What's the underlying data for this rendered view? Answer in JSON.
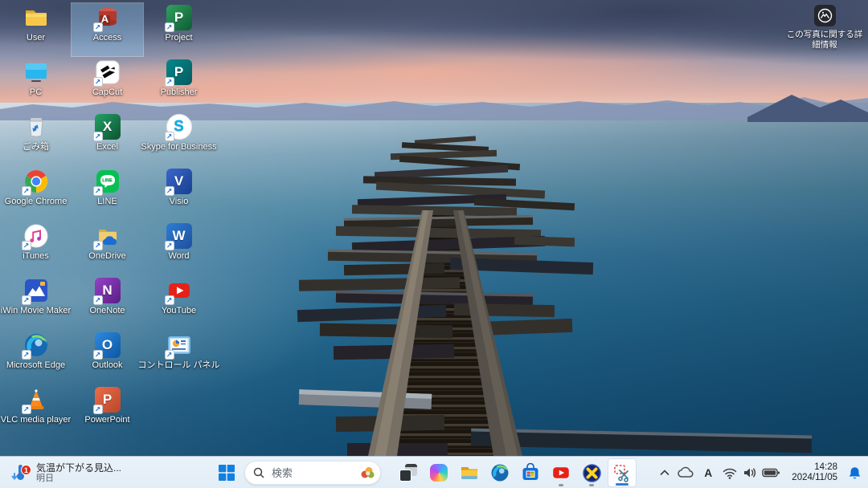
{
  "desktop": {
    "spotlight_label": "この写真に関する詳細情報",
    "selected_icon": "Access",
    "icons": [
      {
        "label": "User"
      },
      {
        "label": "PC"
      },
      {
        "label": "ごみ箱"
      },
      {
        "label": "Google Chrome"
      },
      {
        "label": "iTunes"
      },
      {
        "label": "iWin Movie Maker"
      },
      {
        "label": "Microsoft Edge"
      },
      {
        "label": "VLC media player"
      },
      {
        "label": "Access",
        "glyph": "A"
      },
      {
        "label": "CapCut"
      },
      {
        "label": "Excel",
        "glyph": "X"
      },
      {
        "label": "LINE",
        "glyph": "LINE"
      },
      {
        "label": "OneDrive"
      },
      {
        "label": "OneNote",
        "glyph": "N"
      },
      {
        "label": "Outlook",
        "glyph": "O"
      },
      {
        "label": "PowerPoint",
        "glyph": "P"
      },
      {
        "label": "Project",
        "glyph": "P"
      },
      {
        "label": "Publisher",
        "glyph": "P"
      },
      {
        "label": "Skype for Business",
        "glyph": "S"
      },
      {
        "label": "Visio",
        "glyph": "V"
      },
      {
        "label": "Word",
        "glyph": "W"
      },
      {
        "label": "YouTube"
      },
      {
        "label": "コントロール パネル"
      }
    ]
  },
  "taskbar": {
    "widget": {
      "badge": "1",
      "line1": "気温が下がる見込...",
      "line2": "明日"
    },
    "search": {
      "placeholder": "検索"
    },
    "apps": [
      "start",
      "task-view",
      "copilot",
      "file-explorer",
      "edge",
      "microsoft-store",
      "youtube",
      "x-app",
      "snipping-tool"
    ],
    "active_app": "snipping-tool",
    "running_apps": [
      "youtube",
      "x-app",
      "snipping-tool"
    ],
    "tray": {
      "ime": "A",
      "time": "14:28",
      "date": "2024/11/05"
    }
  },
  "colors": {
    "taskbar_bg": "#e6eff7",
    "accent_blue": "#1a7fd4",
    "selection": "rgba(145,190,228,0.45)",
    "water_deep": "#124a6e",
    "sky_pink": "#ecc0ab"
  }
}
